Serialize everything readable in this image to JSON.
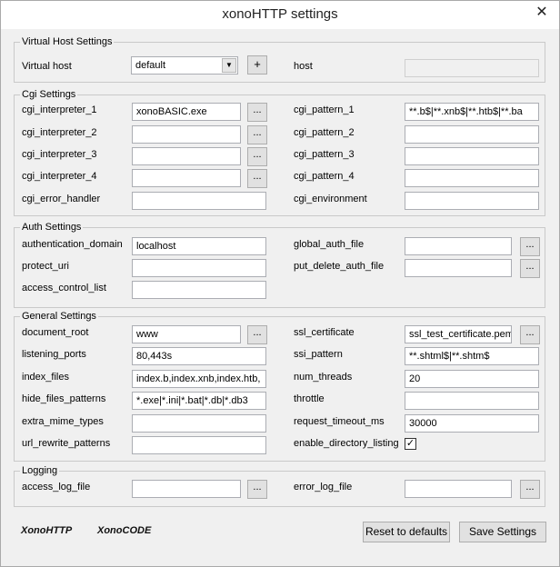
{
  "window": {
    "title": "xonoHTTP settings",
    "close_glyph": "✕"
  },
  "virtual_host": {
    "legend": "Virtual Host Settings",
    "virtual_host_label": "Virtual host",
    "virtual_host_value": "default",
    "add_glyph": "+",
    "host_label": "host",
    "host_value": ""
  },
  "cgi": {
    "legend": "Cgi Settings",
    "interp1_label": "cgi_interpreter_1",
    "interp1_value": "xonoBASIC.exe",
    "interp2_label": "cgi_interpreter_2",
    "interp2_value": "",
    "interp3_label": "cgi_interpreter_3",
    "interp3_value": "",
    "interp4_label": "cgi_interpreter_4",
    "interp4_value": "",
    "error_handler_label": "cgi_error_handler",
    "error_handler_value": "",
    "pattern1_label": "cgi_pattern_1",
    "pattern1_value": "**.b$|**.xnb$|**.htb$|**.ba",
    "pattern2_label": "cgi_pattern_2",
    "pattern2_value": "",
    "pattern3_label": "cgi_pattern_3",
    "pattern3_value": "",
    "pattern4_label": "cgi_pattern_4",
    "pattern4_value": "",
    "environment_label": "cgi_environment",
    "environment_value": ""
  },
  "auth": {
    "legend": "Auth Settings",
    "domain_label": "authentication_domain",
    "domain_value": "localhost",
    "protect_label": "protect_uri",
    "protect_value": "",
    "acl_label": "access_control_list",
    "acl_value": "",
    "global_label": "global_auth_file",
    "global_value": "",
    "put_delete_label": "put_delete_auth_file",
    "put_delete_value": ""
  },
  "general": {
    "legend": "General Settings",
    "doc_root_label": "document_root",
    "doc_root_value": "www",
    "ports_label": "listening_ports",
    "ports_value": "80,443s",
    "index_label": "index_files",
    "index_value": "index.b,index.xnb,index.htb,",
    "hide_label": "hide_files_patterns",
    "hide_value": "*.exe|*.ini|*.bat|*.db|*.db3",
    "mime_label": "extra_mime_types",
    "mime_value": "",
    "rewrite_label": "url_rewrite_patterns",
    "rewrite_value": "",
    "ssl_label": "ssl_certificate",
    "ssl_value": "ssl_test_certificate.pem",
    "ssi_label": "ssi_pattern",
    "ssi_value": "**.shtml$|**.shtm$",
    "threads_label": "num_threads",
    "threads_value": "20",
    "throttle_label": "throttle",
    "throttle_value": "",
    "timeout_label": "request_timeout_ms",
    "timeout_value": "30000",
    "dirlist_label": "enable_directory_listing",
    "dirlist_checked_glyph": "✓"
  },
  "logging": {
    "legend": "Logging",
    "access_label": "access_log_file",
    "access_value": "",
    "error_label": "error_log_file",
    "error_value": ""
  },
  "browse_glyph": "...",
  "footer": {
    "logo1": "XonoHTTP",
    "logo2": "XonoCODE",
    "reset_label": "Reset to defaults",
    "save_label": "Save Settings"
  }
}
